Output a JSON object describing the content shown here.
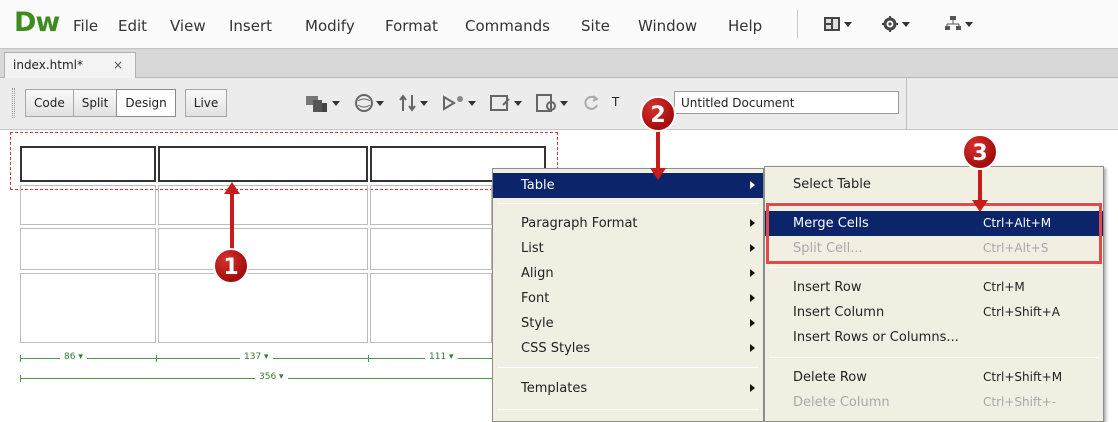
{
  "app": {
    "logo": "Dw"
  },
  "menubar": {
    "items": [
      "File",
      "Edit",
      "View",
      "Insert",
      "Modify",
      "Format",
      "Commands",
      "Site",
      "Window",
      "Help"
    ],
    "icons": [
      "layout-icon",
      "gear-icon",
      "site-icon"
    ]
  },
  "document_tab": {
    "label": "index.html*",
    "close": "×"
  },
  "toolbar": {
    "view_buttons": [
      "Code",
      "Split",
      "Design",
      "Live"
    ],
    "active_view": "Design",
    "icons": [
      "multiscreen-icon",
      "browser-preview-icon",
      "file-management-icon",
      "live-view-icon",
      "visual-aids-icon",
      "check-page-icon",
      "refresh-icon"
    ],
    "title_label": "T",
    "title_value": "Untitled Document"
  },
  "table_widths": {
    "col1": "86 ▾",
    "col2": "137 ▾",
    "col3": "111 ▾",
    "total": "356 ▾"
  },
  "context_menu": {
    "items": [
      {
        "label": "Table",
        "submenu": true,
        "highlighted": true
      },
      {
        "label": "Paragraph Format",
        "submenu": true
      },
      {
        "label": "List",
        "submenu": true
      },
      {
        "label": "Align",
        "submenu": true
      },
      {
        "label": "Font",
        "submenu": true
      },
      {
        "label": "Style",
        "submenu": true
      },
      {
        "label": "CSS Styles",
        "submenu": true
      },
      {
        "label": "Templates",
        "submenu": true
      }
    ]
  },
  "table_submenu": {
    "items": [
      {
        "label": "Select Table",
        "shortcut": ""
      },
      {
        "label": "Merge Cells",
        "shortcut": "Ctrl+Alt+M",
        "highlighted": true
      },
      {
        "label": "Split Cell...",
        "shortcut": "Ctrl+Alt+S",
        "disabled": true
      },
      {
        "label": "Insert Row",
        "shortcut": "Ctrl+M"
      },
      {
        "label": "Insert Column",
        "shortcut": "Ctrl+Shift+A"
      },
      {
        "label": "Insert Rows or Columns...",
        "shortcut": ""
      },
      {
        "label": "Delete Row",
        "shortcut": "Ctrl+Shift+M"
      },
      {
        "label": "Delete Column",
        "shortcut": "Ctrl+Shift+-",
        "disabled": true
      }
    ]
  },
  "callouts": [
    "1",
    "2",
    "3"
  ],
  "colors": {
    "highlight": "#0b246a",
    "menu_bg": "#f1efe2",
    "callout": "#c81c1c",
    "logo": "#3e8c1f"
  }
}
